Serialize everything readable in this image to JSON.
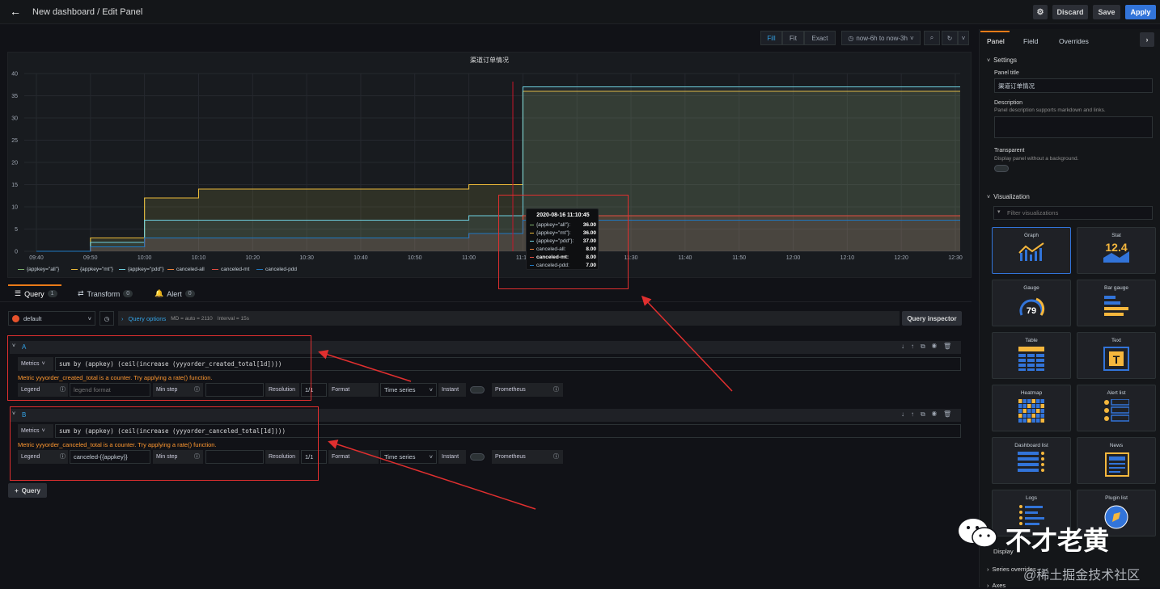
{
  "header": {
    "title": "New dashboard / Edit Panel",
    "discard": "Discard",
    "save": "Save",
    "apply": "Apply"
  },
  "toolbar": {
    "fill": "Fill",
    "fit": "Fit",
    "exact": "Exact",
    "timerange": "now-6h to now-3h"
  },
  "chart_data": {
    "type": "line",
    "title": "渠道订单情况",
    "x": [
      "09:40",
      "09:50",
      "10:00",
      "10:10",
      "10:20",
      "10:30",
      "10:40",
      "10:50",
      "11:00",
      "11:10",
      "11:20",
      "11:30",
      "11:40",
      "11:50",
      "12:00",
      "12:10",
      "12:20",
      "12:30"
    ],
    "ylim": [
      0,
      40
    ],
    "yticks": [
      "40",
      "35",
      "30",
      "25",
      "20",
      "15",
      "10",
      "5",
      "0"
    ],
    "series": [
      {
        "name": "{appkey=\"all\"}",
        "color": "#7eb26d",
        "values": [
          0,
          3,
          12,
          14,
          14,
          14,
          14,
          14,
          15,
          36,
          36,
          36,
          36,
          36,
          36,
          36,
          36,
          36
        ]
      },
      {
        "name": "{appkey=\"mt\"}",
        "color": "#eab839",
        "values": [
          0,
          3,
          12,
          14,
          14,
          14,
          14,
          14,
          15,
          36,
          36,
          36,
          36,
          36,
          36,
          36,
          36,
          36
        ]
      },
      {
        "name": "{appkey=\"pdd\"}",
        "color": "#6ed0e0",
        "values": [
          0,
          2,
          7,
          7,
          7,
          7,
          7,
          7,
          8,
          37,
          37,
          37,
          37,
          37,
          37,
          37,
          37,
          37
        ]
      },
      {
        "name": "canceled-all",
        "color": "#ef843c",
        "values": [
          0,
          1,
          3,
          3,
          3,
          3,
          3,
          3,
          4,
          8,
          8,
          8,
          8,
          8,
          8,
          8,
          8,
          8
        ]
      },
      {
        "name": "canceled-mt",
        "color": "#e24d42",
        "values": [
          0,
          1,
          3,
          3,
          3,
          3,
          3,
          3,
          4,
          8,
          8,
          8,
          8,
          8,
          8,
          8,
          8,
          8
        ]
      },
      {
        "name": "canceled-pdd",
        "color": "#1f78c1",
        "values": [
          0,
          1,
          3,
          3,
          3,
          3,
          3,
          3,
          4,
          7,
          7,
          7,
          7,
          7,
          7,
          7,
          7,
          7
        ]
      }
    ],
    "grid": true,
    "legend": "bottom"
  },
  "tooltip": {
    "time": "2020-08-16 11:10:45",
    "rows": [
      {
        "label": "{appkey=\"all\"}:",
        "value": "36.00",
        "color": "#7eb26d"
      },
      {
        "label": "{appkey=\"mt\"}:",
        "value": "36.00",
        "color": "#eab839"
      },
      {
        "label": "{appkey=\"pdd\"}:",
        "value": "37.00",
        "color": "#6ed0e0"
      },
      {
        "label": "canceled-all:",
        "value": "8.00",
        "color": "#ef843c"
      },
      {
        "label": "canceled-mt:",
        "value": "8.00",
        "color": "#e24d42"
      },
      {
        "label": "canceled-pdd:",
        "value": "7.00",
        "color": "#1f78c1"
      }
    ]
  },
  "tabs": [
    {
      "label": "Query",
      "count": "1"
    },
    {
      "label": "Transform",
      "count": "0"
    },
    {
      "label": "Alert",
      "count": "0"
    }
  ],
  "datasource": {
    "name": "default",
    "options": "Query options",
    "md": "MD = auto = 2110",
    "interval": "Interval = 15s",
    "inspector": "Query inspector"
  },
  "queryA": {
    "letter": "A",
    "metrics": "Metrics",
    "expr": "sum by (appkey) (ceil(increase (yyyorder_created_total[1d])))",
    "warn": "Metric yyyorder_created_total is a counter. Try applying a rate() function.",
    "legend": "Legend",
    "legend_ph": "legend format",
    "legend_val": "",
    "minstep": "Min step",
    "resolution": "Resolution",
    "res_val": "1/1",
    "format": "Format",
    "format_val": "Time series",
    "instant": "Instant",
    "prometheus": "Prometheus"
  },
  "queryB": {
    "letter": "B",
    "metrics": "Metrics",
    "expr": "sum by (appkey) (ceil(increase (yyyorder_canceled_total[1d])))",
    "warn": "Metric yyyorder_canceled_total is a counter. Try applying a rate() function.",
    "legend": "Legend",
    "legend_ph": "",
    "legend_val": "canceled-{{appkey}}",
    "minstep": "Min step",
    "resolution": "Resolution",
    "res_val": "1/1",
    "format": "Format",
    "format_val": "Time series",
    "instant": "Instant",
    "prometheus": "Prometheus"
  },
  "addquery": "Query",
  "right": {
    "tabs": [
      "Panel",
      "Field",
      "Overrides"
    ],
    "settings": "Settings",
    "ptitle_label": "Panel title",
    "ptitle": "渠道订单情况",
    "desc_label": "Description",
    "desc_hint": "Panel description supports markdown and links.",
    "transparent": "Transparent",
    "transparent_hint": "Display panel without a background.",
    "visualization": "Visualization",
    "filter": "Filter visualizations",
    "viz": [
      "Graph",
      "Stat",
      "Gauge",
      "Bar gauge",
      "Table",
      "Text",
      "Heatmap",
      "Alert list",
      "Dashboard list",
      "News",
      "Logs",
      "Plugin list"
    ],
    "stat_val": "12.4",
    "gauge_val": "79",
    "display": "Display",
    "series_overrides": "Series overrides",
    "axes": "Axes"
  },
  "watermark": {
    "brand": "不才老黄",
    "site": "@稀土掘金技术社区"
  }
}
